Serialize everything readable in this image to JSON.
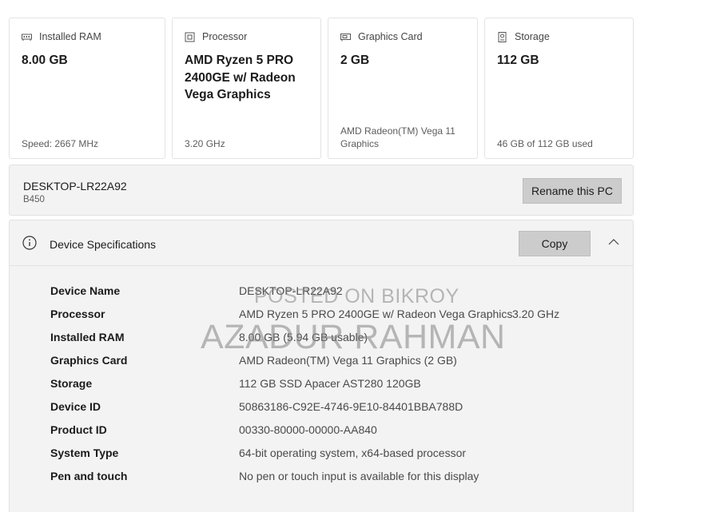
{
  "cards": [
    {
      "id": "ram",
      "title": "Installed RAM",
      "value": "8.00 GB",
      "footer": "Speed: 2667 MHz",
      "icon": "ram-icon"
    },
    {
      "id": "processor",
      "title": "Processor",
      "value": "AMD Ryzen 5 PRO 2400GE w/ Radeon Vega Graphics",
      "footer": "3.20 GHz",
      "icon": "processor-icon"
    },
    {
      "id": "graphics",
      "title": "Graphics Card",
      "value": "2 GB",
      "footer": "AMD Radeon(TM) Vega 11 Graphics",
      "icon": "graphics-card-icon"
    },
    {
      "id": "storage",
      "title": "Storage",
      "value": "112 GB",
      "footer": "46 GB of 112 GB used",
      "icon": "storage-icon"
    }
  ],
  "pc": {
    "name": "DESKTOP-LR22A92",
    "model": "B450",
    "rename_label": "Rename this PC"
  },
  "specs": {
    "title": "Device Specifications",
    "copy_label": "Copy",
    "rows": [
      {
        "label": "Device Name",
        "value": "DESKTOP-LR22A92"
      },
      {
        "label": "Processor",
        "value": "AMD Ryzen 5 PRO 2400GE w/ Radeon Vega Graphics",
        "extra": "3.20 GHz"
      },
      {
        "label": "Installed RAM",
        "value": "8.00 GB (5.94 GB usable)"
      },
      {
        "label": "Graphics Card",
        "value": "AMD Radeon(TM) Vega 11 Graphics (2 GB)"
      },
      {
        "label": "Storage",
        "value": "112 GB SSD Apacer AST280 120GB"
      },
      {
        "label": "Device ID",
        "value": "50863186-C92E-4746-9E10-84401BBA788D"
      },
      {
        "label": "Product ID",
        "value": "00330-80000-00000-AA840"
      },
      {
        "label": "System Type",
        "value": "64-bit operating system, x64-based processor"
      },
      {
        "label": "Pen and touch",
        "value": "No pen or touch input is available for this display"
      }
    ]
  },
  "watermark": {
    "line1": "POSTED ON BIKROY",
    "line2": "AZADUR RAHMAN"
  }
}
